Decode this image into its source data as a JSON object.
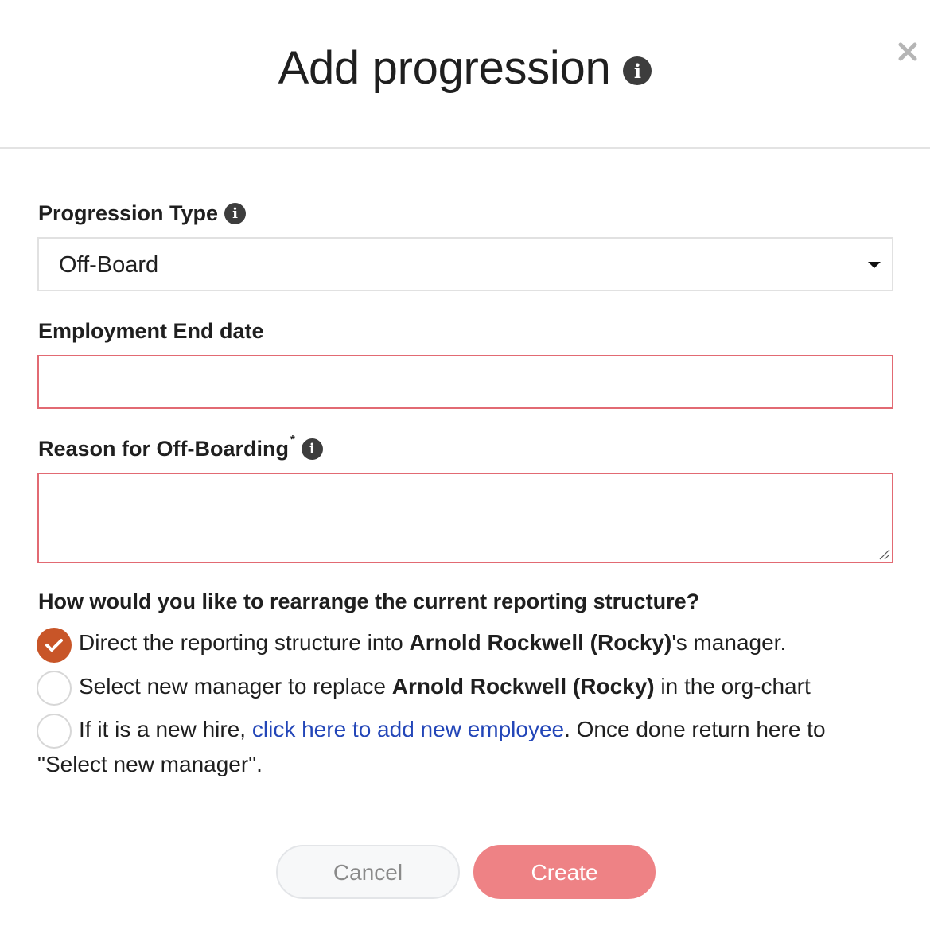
{
  "header": {
    "title": "Add progression",
    "info_icon": "info-circle-icon",
    "close_icon": "close-icon"
  },
  "form": {
    "progression_type": {
      "label": "Progression Type",
      "selected": "Off-Board"
    },
    "end_date": {
      "label": "Employment End date",
      "value": ""
    },
    "reason": {
      "label": "Reason for Off-Boarding",
      "required_mark": "*",
      "value": ""
    },
    "reporting": {
      "question": "How would you like to rearrange the current reporting structure?",
      "options": [
        {
          "checked": true,
          "text_before": "Direct the reporting structure into ",
          "bold": "Arnold Rockwell (Rocky)",
          "text_after": "'s manager."
        },
        {
          "checked": false,
          "text_before": "Select new manager to replace ",
          "bold": "Arnold Rockwell (Rocky)",
          "text_after": " in the org-chart"
        },
        {
          "checked": false,
          "text_before": "If it is a new hire, ",
          "link": "click here to add new employee",
          "text_after": ". Once done return here to",
          "text_line2": "\"Select new manager\"."
        }
      ]
    }
  },
  "buttons": {
    "cancel": "Cancel",
    "create": "Create"
  },
  "colors": {
    "error_border": "#e26a73",
    "radio_checked": "#c85528",
    "create_button": "#ee8285",
    "link": "#2346b8"
  }
}
